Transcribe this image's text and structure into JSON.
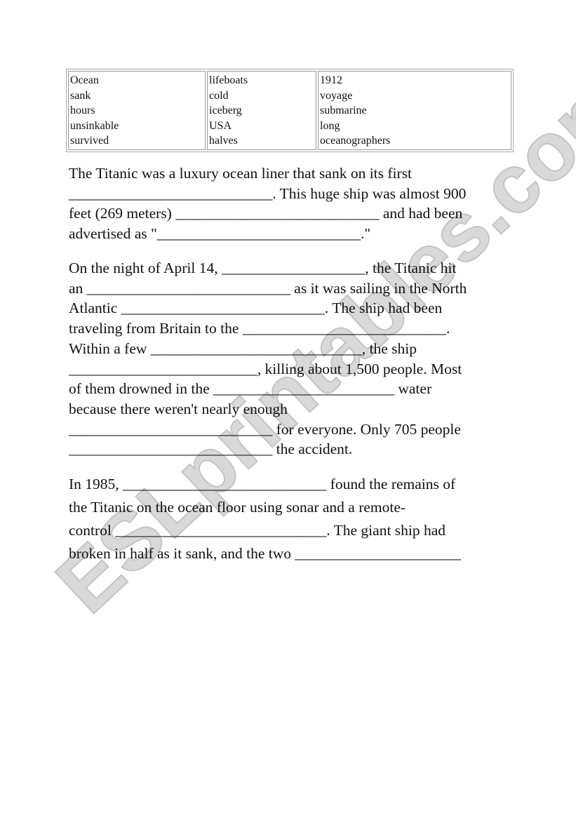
{
  "word_bank": {
    "columns": [
      [
        "Ocean",
        "sank",
        "hours",
        "unsinkable",
        "survived"
      ],
      [
        "lifeboats",
        "cold",
        "iceberg",
        "USA",
        "halves"
      ],
      [
        "1912",
        "voyage",
        "submarine",
        "long",
        "oceanographers"
      ]
    ]
  },
  "paragraphs": [
    {
      "lines": [
        "The Titanic was a luxury ocean liner that sank on its first",
        "___________________________. This huge ship was almost 900",
        "feet (269 meters) ___________________________ and had been",
        "advertised as \"___________________________.\""
      ]
    },
    {
      "lines": [
        "On the night of April 14, ___________________, the Titanic hit",
        "an ___________________________ as it was sailing in the North",
        "Atlantic ___________________________. The ship had been",
        "traveling from Britain to the ___________________________.",
        "Within a few ____________________________, the ship",
        "_________________________, killing about 1,500 people. Most",
        "of them drowned in the ________________________ water",
        "because there weren't nearly enough",
        "___________________________ for everyone. Only 705 people",
        "___________________________ the accident."
      ]
    },
    {
      "lines": [
        "In 1985, ___________________________ found the remains of",
        "the Titanic on the ocean floor using sonar and a remote-",
        "control ____________________________. The giant ship had",
        "broken in half as it sank, and the two ______________________"
      ]
    }
  ],
  "watermark": {
    "text": "ESLprintables.com",
    "color": "#d9d9d9"
  }
}
